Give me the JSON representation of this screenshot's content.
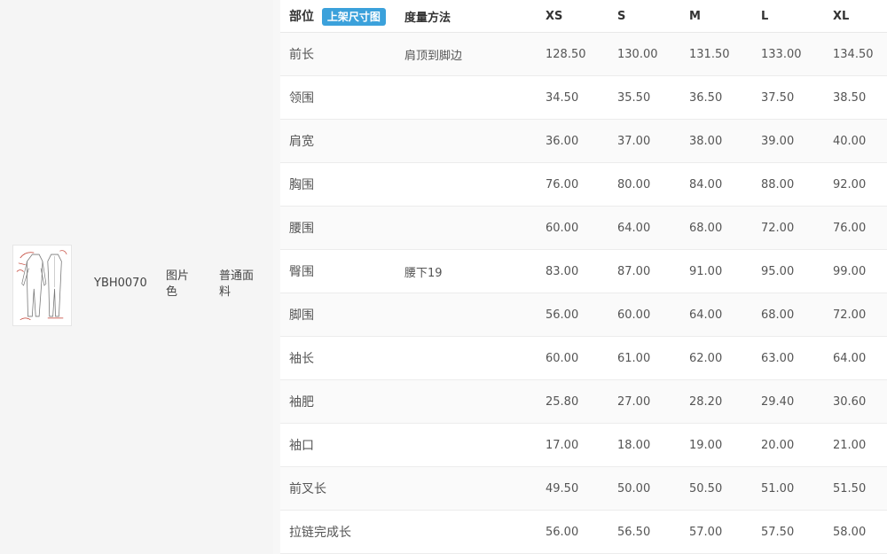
{
  "product": {
    "code": "YBH0070",
    "color": "图片色",
    "fabric": "普通面料"
  },
  "table": {
    "headers": {
      "part": "部位",
      "tag": "上架尺寸图",
      "method": "度量方法",
      "sizes": [
        "XS",
        "S",
        "M",
        "L",
        "XL"
      ]
    },
    "rows": [
      {
        "part": "前长",
        "method": "肩顶到脚边",
        "values": [
          "128.50",
          "130.00",
          "131.50",
          "133.00",
          "134.50"
        ]
      },
      {
        "part": "领围",
        "method": "",
        "values": [
          "34.50",
          "35.50",
          "36.50",
          "37.50",
          "38.50"
        ]
      },
      {
        "part": "肩宽",
        "method": "",
        "values": [
          "36.00",
          "37.00",
          "38.00",
          "39.00",
          "40.00"
        ]
      },
      {
        "part": "胸围",
        "method": "",
        "values": [
          "76.00",
          "80.00",
          "84.00",
          "88.00",
          "92.00"
        ]
      },
      {
        "part": "腰围",
        "method": "",
        "values": [
          "60.00",
          "64.00",
          "68.00",
          "72.00",
          "76.00"
        ]
      },
      {
        "part": "臀围",
        "method": "腰下19",
        "values": [
          "83.00",
          "87.00",
          "91.00",
          "95.00",
          "99.00"
        ]
      },
      {
        "part": "脚围",
        "method": "",
        "values": [
          "56.00",
          "60.00",
          "64.00",
          "68.00",
          "72.00"
        ]
      },
      {
        "part": "袖长",
        "method": "",
        "values": [
          "60.00",
          "61.00",
          "62.00",
          "63.00",
          "64.00"
        ]
      },
      {
        "part": "袖肥",
        "method": "",
        "values": [
          "25.80",
          "27.00",
          "28.20",
          "29.40",
          "30.60"
        ]
      },
      {
        "part": "袖口",
        "method": "",
        "values": [
          "17.00",
          "18.00",
          "19.00",
          "20.00",
          "21.00"
        ]
      },
      {
        "part": "前叉长",
        "method": "",
        "values": [
          "49.50",
          "50.00",
          "50.50",
          "51.00",
          "51.50"
        ]
      },
      {
        "part": "拉链完成长",
        "method": "",
        "values": [
          "56.00",
          "56.50",
          "57.00",
          "57.50",
          "58.00"
        ]
      }
    ]
  },
  "colors": {
    "tag_bg": "#3ba1db",
    "sketch_ink": "#c0392b"
  }
}
